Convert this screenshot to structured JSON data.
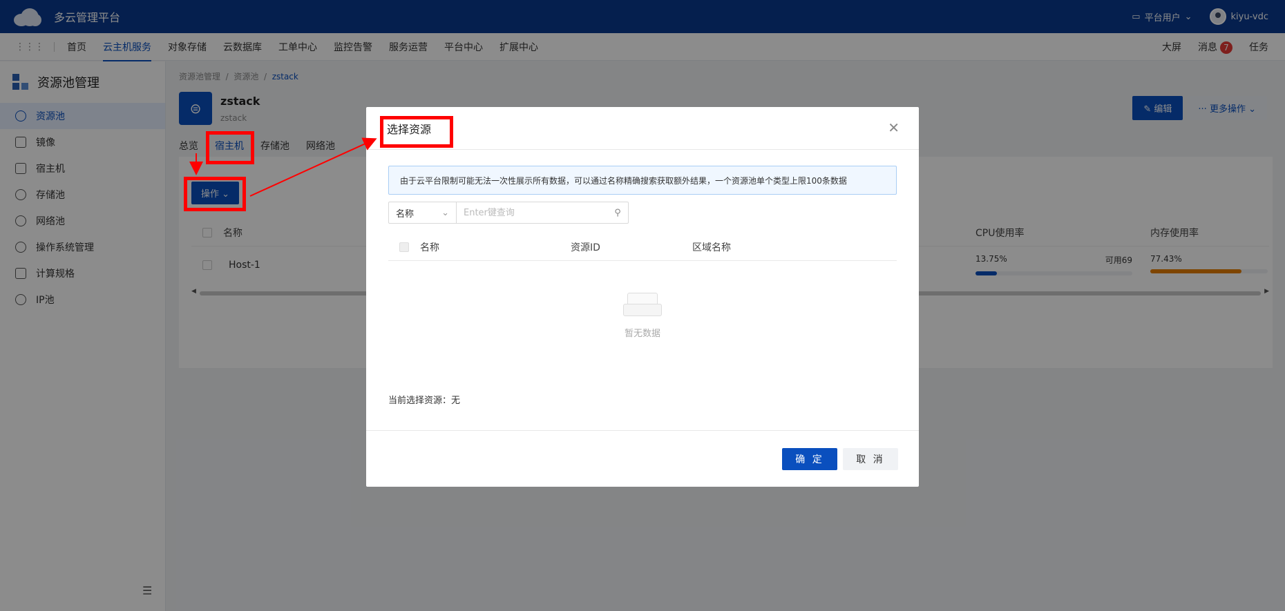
{
  "app": {
    "title": "多云管理平台",
    "platform_user": "平台用户",
    "username": "kiyu-vdc"
  },
  "nav": {
    "menu": [
      "首页",
      "云主机服务",
      "对象存储",
      "云数据库",
      "工单中心",
      "监控告警",
      "服务运营",
      "平台中心",
      "扩展中心"
    ],
    "active_index": 1,
    "right": {
      "bigscreen": "大屏",
      "messages": "消息",
      "message_count": "7",
      "tasks": "任务"
    }
  },
  "sidebar": {
    "title": "资源池管理",
    "items": [
      "资源池",
      "镜像",
      "宿主机",
      "存储池",
      "网络池",
      "操作系统管理",
      "计算规格",
      "IP池"
    ],
    "active_index": 0
  },
  "page": {
    "breadcrumb": [
      "资源池管理",
      "资源池",
      "zstack"
    ],
    "name": "zstack",
    "subname": "zstack",
    "edit_label": "编辑",
    "more_label": "更多操作",
    "tabs": [
      "总览",
      "宿主机",
      "存储池",
      "网络池"
    ],
    "active_tab": 1,
    "op_button": "操作",
    "table": {
      "headers": {
        "name": "名称",
        "cpu": "CPU使用率",
        "mem": "内存使用率"
      },
      "row": {
        "name": "Host-1",
        "cpu_pct": "13.75%",
        "cpu_avail": "可用69",
        "cpu_value": 13.75,
        "mem_pct": "77.43%",
        "mem_value": 77.43
      }
    }
  },
  "modal": {
    "title": "选择资源",
    "notice": "由于云平台限制可能无法一次性展示所有数据，可以通过名称精确搜索获取额外结果，一个资源池单个类型上限100条数据",
    "search_field": "名称",
    "search_placeholder": "Enter键查询",
    "columns": [
      "名称",
      "资源ID",
      "区域名称"
    ],
    "empty_text": "暂无数据",
    "current_selection": "当前选择资源：无",
    "ok_label": "确 定",
    "cancel_label": "取 消"
  },
  "colors": {
    "brand": "#0a3a8f",
    "primary": "#0a4fbe",
    "mem_bar": "#e67e00",
    "annotation": "#ff0000"
  }
}
